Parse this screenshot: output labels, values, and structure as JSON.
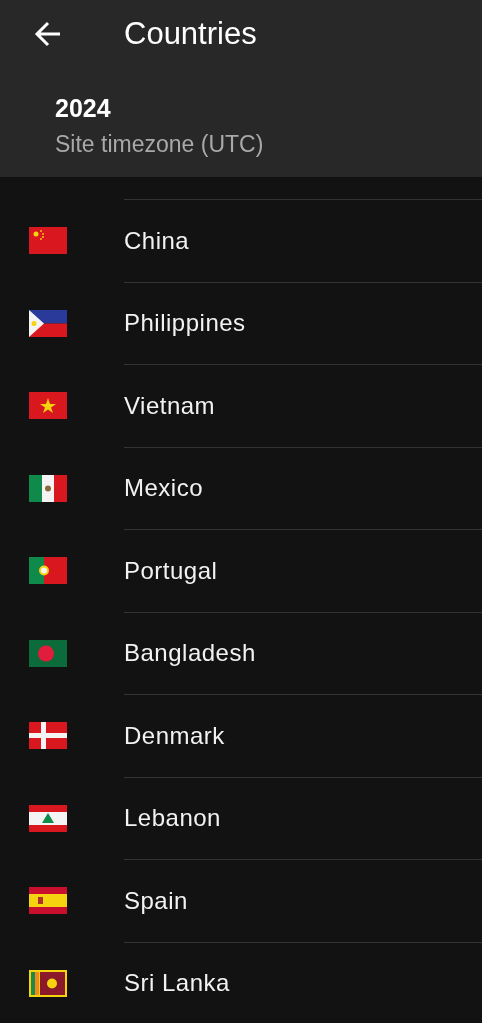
{
  "app_bar": {
    "title": "Countries"
  },
  "header": {
    "year": "2024",
    "subtitle": "Site timezone (UTC)"
  },
  "countries": [
    {
      "name": "China"
    },
    {
      "name": "Philippines"
    },
    {
      "name": "Vietnam"
    },
    {
      "name": "Mexico"
    },
    {
      "name": "Portugal"
    },
    {
      "name": "Bangladesh"
    },
    {
      "name": "Denmark"
    },
    {
      "name": "Lebanon"
    },
    {
      "name": "Spain"
    },
    {
      "name": "Sri Lanka"
    }
  ]
}
